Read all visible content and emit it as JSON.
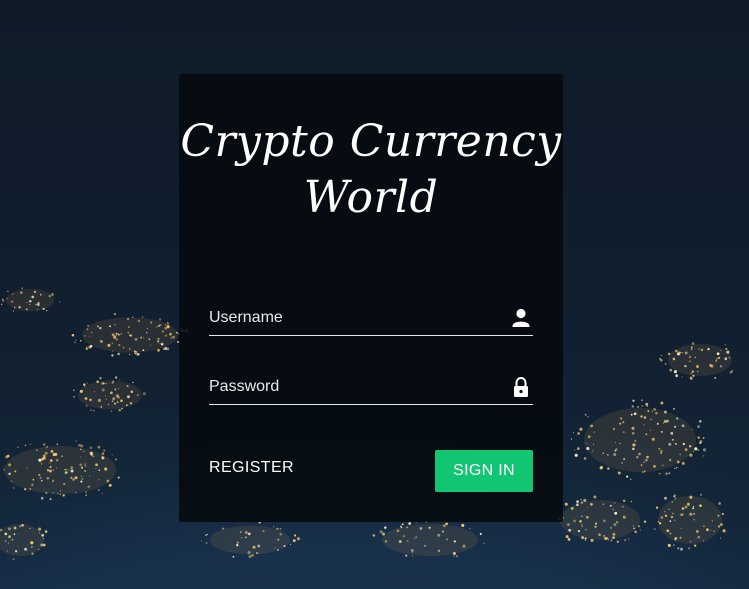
{
  "login": {
    "title": "Crypto Currency World",
    "username_placeholder": "Username",
    "password_placeholder": "Password",
    "register_label": "REGISTER",
    "signin_label": "SIGN IN",
    "icons": {
      "username": "user-icon",
      "password": "lock-icon"
    },
    "colors": {
      "signin_button": "#12c572",
      "card": "#05090d",
      "background": "#0e1a28"
    }
  }
}
